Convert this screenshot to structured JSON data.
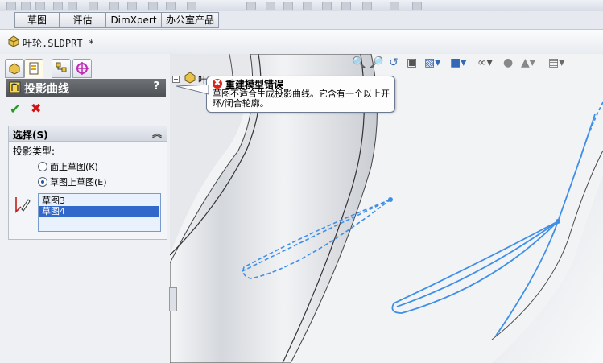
{
  "command_tabs": [
    "草图",
    "评估",
    "DimXpert",
    "办公室产品"
  ],
  "document": {
    "title": "叶轮.SLDPRT *"
  },
  "panel_tabs": [
    "feature-manager-icon",
    "property-manager-icon",
    "configuration-manager-icon",
    "dim-xpert-manager-icon"
  ],
  "feature": {
    "title": "投影曲线",
    "help": "?",
    "ok_icon": "✔",
    "cancel_icon": "✖"
  },
  "selection": {
    "header": "选择(S)",
    "collapse_icon": "︽",
    "projection_type_label": "投影类型:",
    "options": [
      {
        "label": "面上草图(K)",
        "selected": false
      },
      {
        "label": "草图上草图(E)",
        "selected": true
      }
    ],
    "list": [
      {
        "label": "草图3",
        "selected": false
      },
      {
        "label": "草图4",
        "selected": true
      }
    ]
  },
  "tree": {
    "root_label": "叶"
  },
  "error": {
    "title": "重建模型错误",
    "message": "草图不适合生成投影曲线。它含有一个以上开环/闭合轮廓。"
  },
  "view_toolbar": [
    "zoom-to-fit-icon",
    "zoom-area-icon",
    "previous-view-icon",
    "section-view-icon",
    "view-orientation-icon",
    "display-style-icon",
    "hide-show-icon",
    "edit-appearance-icon",
    "apply-scene-icon",
    "view-settings-icon"
  ],
  "colors": {
    "sketch_blue": "#3f8fe8",
    "header_grey": "#5c5f63",
    "error_red": "#d8261e"
  }
}
